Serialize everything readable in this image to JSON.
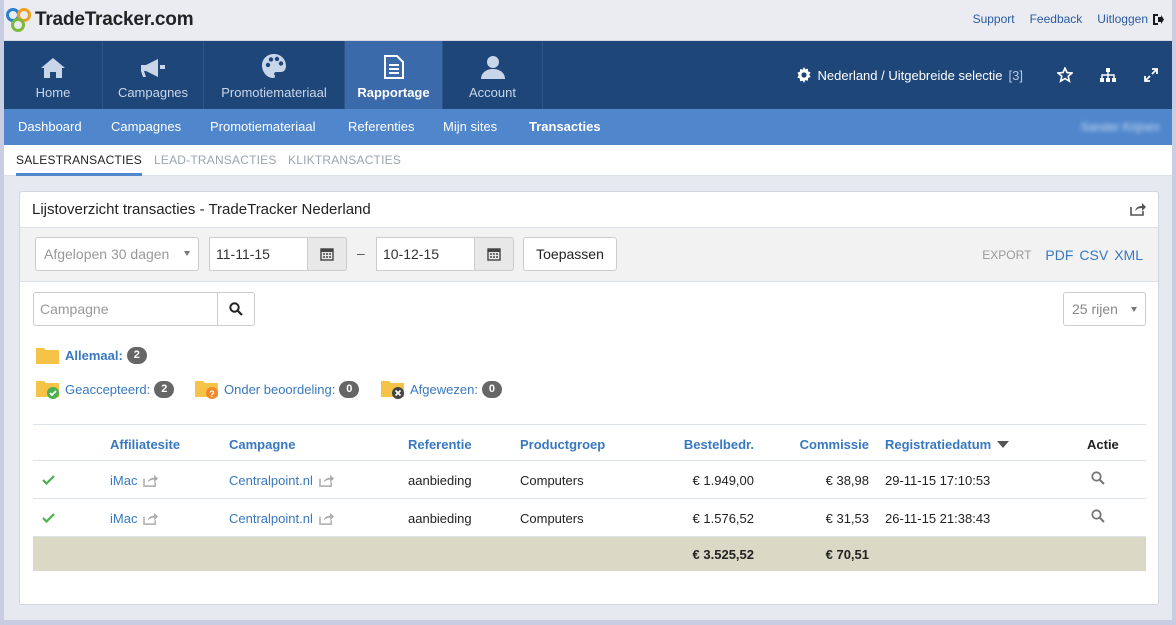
{
  "brand": {
    "name": "TradeTracker.com"
  },
  "toplinks": [
    "Support",
    "Feedback",
    "Uitloggen"
  ],
  "mainnav": {
    "tabs": [
      {
        "label": "Home",
        "icon": "home-icon"
      },
      {
        "label": "Campagnes",
        "icon": "megaphone-icon"
      },
      {
        "label": "Promotiemateriaal",
        "icon": "palette-icon"
      },
      {
        "label": "Rapportage",
        "icon": "document-icon",
        "active": true
      },
      {
        "label": "Account",
        "icon": "user-icon"
      }
    ],
    "selection": "Nederland / Uitgebreide selectie",
    "selection_count": "[3]"
  },
  "subnav": {
    "items": [
      "Dashboard",
      "Campagnes",
      "Promotiemateriaal",
      "Referenties",
      "Mijn sites",
      "Transacties"
    ],
    "active": "Transacties",
    "username": "Sander Krijnen"
  },
  "tabs": [
    "SALESTRANSACTIES",
    "LEAD-TRANSACTIES",
    "KLIKTRANSACTIES"
  ],
  "panel": {
    "title": "Lijstoverzicht transacties - TradeTracker Nederland",
    "period": "Afgelopen 30 dagen",
    "date_from": "11-11-15",
    "date_to": "10-12-15",
    "dash": "–",
    "apply": "Toepassen",
    "export_label": "EXPORT",
    "export_formats": [
      "PDF",
      "CSV",
      "XML"
    ],
    "search_placeholder": "Campagne",
    "rows_select": "25 rijen"
  },
  "status": {
    "all": {
      "label": "Allemaal:",
      "count": "2"
    },
    "accepted": {
      "label": "Geaccepteerd:",
      "count": "2"
    },
    "pending": {
      "label": "Onder beoordeling:",
      "count": "0"
    },
    "rejected": {
      "label": "Afgewezen:",
      "count": "0"
    }
  },
  "table": {
    "headers": [
      "Affiliatesite",
      "Campagne",
      "Referentie",
      "Productgroep",
      "Bestelbedr.",
      "Commissie",
      "Registratiedatum",
      "Actie"
    ],
    "rows": [
      {
        "site": "iMac",
        "campaign": "Centralpoint.nl",
        "reference": "aanbieding",
        "group": "Computers",
        "amount": "€ 1.949,00",
        "commission": "€ 38,98",
        "date": "29-11-15 17:10:53"
      },
      {
        "site": "iMac",
        "campaign": "Centralpoint.nl",
        "reference": "aanbieding",
        "group": "Computers",
        "amount": "€ 1.576,52",
        "commission": "€ 31,53",
        "date": "26-11-15 21:38:43"
      }
    ],
    "totals": {
      "amount": "€ 3.525,52",
      "commission": "€ 70,51"
    }
  },
  "colors": {
    "nav": "#1e4678",
    "nav_active": "#3b6aaa",
    "subnav": "#4f86cc",
    "link": "#3878c0",
    "accepted": "#4caf50",
    "pending": "#f0a030",
    "total_row": "#d9d9c6"
  }
}
